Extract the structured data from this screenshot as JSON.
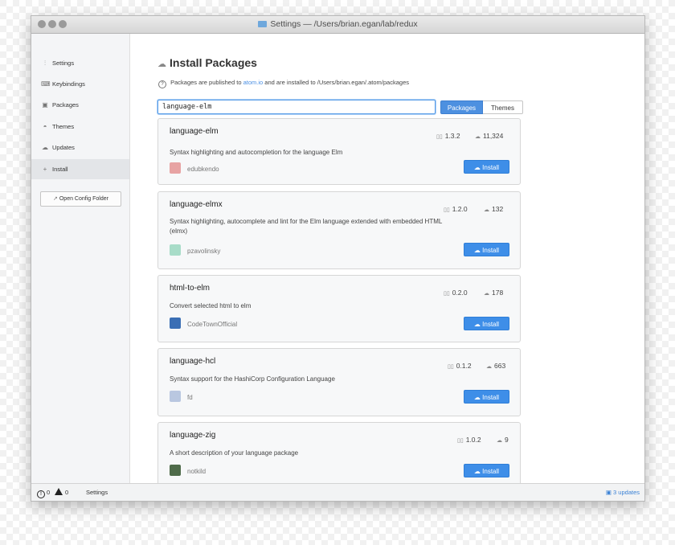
{
  "window": {
    "title": "Settings — /Users/brian.egan/lab/redux"
  },
  "sidebar": {
    "items": [
      {
        "label": "Settings",
        "icon": "sliders-icon"
      },
      {
        "label": "Keybindings",
        "icon": "keyboard-icon"
      },
      {
        "label": "Packages",
        "icon": "package-icon"
      },
      {
        "label": "Themes",
        "icon": "paintcan-icon"
      },
      {
        "label": "Updates",
        "icon": "cloud-download-icon"
      },
      {
        "label": "Install",
        "icon": "plus-icon"
      }
    ],
    "active": "Install",
    "config_button": "Open Config Folder"
  },
  "main": {
    "heading": "Install Packages",
    "note_prefix": "Packages are published to",
    "note_link": "atom.io",
    "note_suffix": "and are installed to /Users/brian.egan/.atom/packages",
    "search_value": "language-elm",
    "toggle": {
      "packages": "Packages",
      "themes": "Themes",
      "active": "Packages"
    },
    "install_label": "Install",
    "packages": [
      {
        "name": "language-elm",
        "description": "Syntax highlighting and autocompletion for the language Elm",
        "version": "1.3.2",
        "downloads": "11,324",
        "author": "edubkendo"
      },
      {
        "name": "language-elmx",
        "description": "Syntax highlighting, autocomplete and lint for the Elm language extended with embedded HTML (elmx)",
        "version": "1.2.0",
        "downloads": "132",
        "author": "pzavolinsky"
      },
      {
        "name": "html-to-elm",
        "description": "Convert selected html to elm",
        "version": "0.2.0",
        "downloads": "178",
        "author": "CodeTownOfficial"
      },
      {
        "name": "language-hcl",
        "description": "Syntax support for the HashiCorp Configuration Language",
        "version": "0.1.2",
        "downloads": "663",
        "author": "fd"
      },
      {
        "name": "language-zig",
        "description": "A short description of your language package",
        "version": "1.0.2",
        "downloads": "9",
        "author": "notkild"
      }
    ]
  },
  "statusbar": {
    "errors": "0",
    "warnings": "0",
    "label": "Settings",
    "updates": "3 updates"
  },
  "colors": {
    "accent": "#3e8ee8",
    "link": "#4a8fe3"
  }
}
